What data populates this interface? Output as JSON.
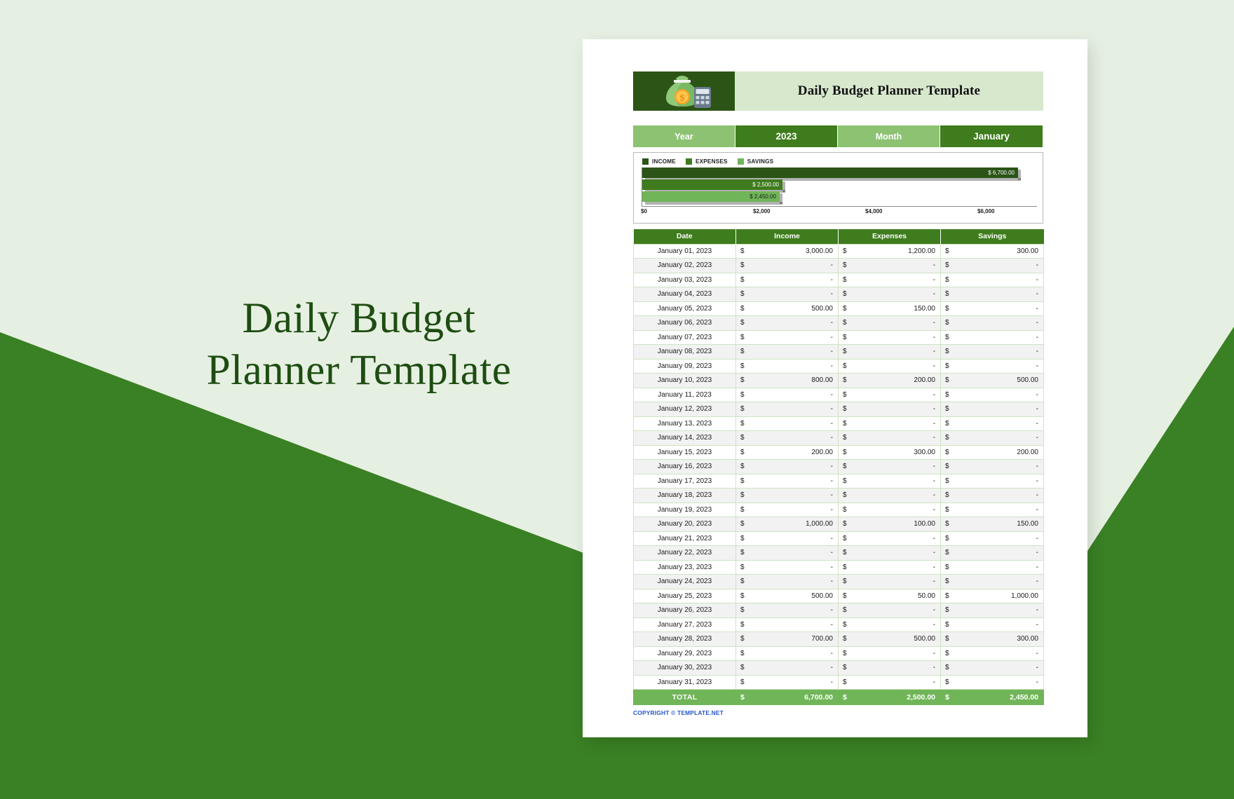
{
  "promo": {
    "line1": "Daily Budget",
    "line2": "Planner Template"
  },
  "document": {
    "title": "Daily Budget Planner Template",
    "logo_icon": "money-bag-calculator-icon",
    "copyright": "COPYRIGHT © TEMPLATE.NET"
  },
  "controls": {
    "year_label": "Year",
    "year_value": "2023",
    "month_label": "Month",
    "month_value": "January"
  },
  "colors": {
    "income": "#2b5416",
    "expenses": "#3e7c1d",
    "savings": "#70b558",
    "header_green": "#3e7c1d",
    "light_green": "#8cc272",
    "pale_green": "#d7e8cd",
    "page_bg": "#e6f0e2",
    "band": "#3a8024",
    "promo_text": "#1e4d12",
    "copyright_blue": "#2255cc"
  },
  "chart_data": {
    "type": "bar",
    "orientation": "horizontal",
    "title": "",
    "categories": [
      "INCOME",
      "EXPENSES",
      "SAVINGS"
    ],
    "values": [
      6700,
      2500,
      2450
    ],
    "data_labels": [
      "$ 6,700.00",
      "$ 2,500.00",
      "$ 2,450.00"
    ],
    "series": [
      {
        "name": "INCOME",
        "values": [
          6700
        ],
        "color": "#2b5416"
      },
      {
        "name": "EXPENSES",
        "values": [
          2500
        ],
        "color": "#3e7c1d"
      },
      {
        "name": "SAVINGS",
        "values": [
          2450
        ],
        "color": "#70b558"
      }
    ],
    "xlabel": "",
    "ylabel": "",
    "xlim": [
      0,
      7000
    ],
    "xticks": [
      0,
      2000,
      4000,
      6000
    ],
    "xtick_labels": [
      "$0",
      "$2,000",
      "$4,000",
      "$6,000"
    ],
    "grid": false,
    "legend": "top-left"
  },
  "table": {
    "columns": [
      "Date",
      "Income",
      "Expenses",
      "Savings"
    ],
    "currency": "$",
    "rows": [
      {
        "date": "January 01, 2023",
        "income": "3,000.00",
        "expenses": "1,200.00",
        "savings": "300.00"
      },
      {
        "date": "January 02, 2023",
        "income": "-",
        "expenses": "-",
        "savings": "-"
      },
      {
        "date": "January 03, 2023",
        "income": "-",
        "expenses": "-",
        "savings": "-"
      },
      {
        "date": "January 04, 2023",
        "income": "-",
        "expenses": "-",
        "savings": "-"
      },
      {
        "date": "January 05, 2023",
        "income": "500.00",
        "expenses": "150.00",
        "savings": "-"
      },
      {
        "date": "January 06, 2023",
        "income": "-",
        "expenses": "-",
        "savings": "-"
      },
      {
        "date": "January 07, 2023",
        "income": "-",
        "expenses": "-",
        "savings": "-"
      },
      {
        "date": "January 08, 2023",
        "income": "-",
        "expenses": "-",
        "savings": "-"
      },
      {
        "date": "January 09, 2023",
        "income": "-",
        "expenses": "-",
        "savings": "-"
      },
      {
        "date": "January 10, 2023",
        "income": "800.00",
        "expenses": "200.00",
        "savings": "500.00"
      },
      {
        "date": "January 11, 2023",
        "income": "-",
        "expenses": "-",
        "savings": "-"
      },
      {
        "date": "January 12, 2023",
        "income": "-",
        "expenses": "-",
        "savings": "-"
      },
      {
        "date": "January 13, 2023",
        "income": "-",
        "expenses": "-",
        "savings": "-"
      },
      {
        "date": "January 14, 2023",
        "income": "-",
        "expenses": "-",
        "savings": "-"
      },
      {
        "date": "January 15, 2023",
        "income": "200.00",
        "expenses": "300.00",
        "savings": "200.00"
      },
      {
        "date": "January 16, 2023",
        "income": "-",
        "expenses": "-",
        "savings": "-"
      },
      {
        "date": "January 17, 2023",
        "income": "-",
        "expenses": "-",
        "savings": "-"
      },
      {
        "date": "January 18, 2023",
        "income": "-",
        "expenses": "-",
        "savings": "-"
      },
      {
        "date": "January 19, 2023",
        "income": "-",
        "expenses": "-",
        "savings": "-"
      },
      {
        "date": "January 20, 2023",
        "income": "1,000.00",
        "expenses": "100.00",
        "savings": "150.00"
      },
      {
        "date": "January 21, 2023",
        "income": "-",
        "expenses": "-",
        "savings": "-"
      },
      {
        "date": "January 22, 2023",
        "income": "-",
        "expenses": "-",
        "savings": "-"
      },
      {
        "date": "January 23, 2023",
        "income": "-",
        "expenses": "-",
        "savings": "-"
      },
      {
        "date": "January 24, 2023",
        "income": "-",
        "expenses": "-",
        "savings": "-"
      },
      {
        "date": "January 25, 2023",
        "income": "500.00",
        "expenses": "50.00",
        "savings": "1,000.00"
      },
      {
        "date": "January 26, 2023",
        "income": "-",
        "expenses": "-",
        "savings": "-"
      },
      {
        "date": "January 27, 2023",
        "income": "-",
        "expenses": "-",
        "savings": "-"
      },
      {
        "date": "January 28, 2023",
        "income": "700.00",
        "expenses": "500.00",
        "savings": "300.00"
      },
      {
        "date": "January 29, 2023",
        "income": "-",
        "expenses": "-",
        "savings": "-"
      },
      {
        "date": "January 30, 2023",
        "income": "-",
        "expenses": "-",
        "savings": "-"
      },
      {
        "date": "January 31, 2023",
        "income": "-",
        "expenses": "-",
        "savings": "-"
      }
    ],
    "total": {
      "label": "TOTAL",
      "income": "6,700.00",
      "expenses": "2,500.00",
      "savings": "2,450.00"
    }
  }
}
